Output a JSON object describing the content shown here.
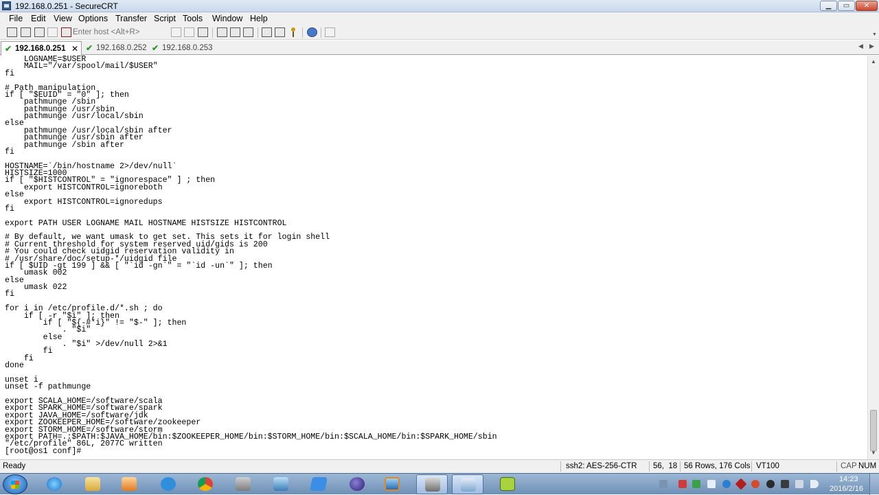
{
  "window": {
    "title": "192.168.0.251 - SecureCRT"
  },
  "menu": [
    "File",
    "Edit",
    "View",
    "Options",
    "Transfer",
    "Script",
    "Tools",
    "Window",
    "Help"
  ],
  "toolbar": {
    "host_placeholder": "Enter host <Alt+R>"
  },
  "tabs": [
    {
      "label": "192.168.0.251",
      "active": true,
      "connected": true
    },
    {
      "label": "192.168.0.252",
      "active": false,
      "connected": true
    },
    {
      "label": "192.168.0.253",
      "active": false,
      "connected": true
    }
  ],
  "terminal": {
    "lines": [
      "    LOGNAME=$USER",
      "    MAIL=\"/var/spool/mail/$USER\"",
      "fi",
      "",
      "# Path manipulation",
      "if [ \"$EUID\" = \"0\" ]; then",
      "    pathmunge /sbin",
      "    pathmunge /usr/sbin",
      "    pathmunge /usr/local/sbin",
      "else",
      "    pathmunge /usr/local/sbin after",
      "    pathmunge /usr/sbin after",
      "    pathmunge /sbin after",
      "fi",
      "",
      "HOSTNAME=`/bin/hostname 2>/dev/null`",
      "HISTSIZE=1000",
      "if [ \"$HISTCONTROL\" = \"ignorespace\" ] ; then",
      "    export HISTCONTROL=ignoreboth",
      "else",
      "    export HISTCONTROL=ignoredups",
      "fi",
      "",
      "export PATH USER LOGNAME MAIL HOSTNAME HISTSIZE HISTCONTROL",
      "",
      "# By default, we want umask to get set. This sets it for login shell",
      "# Current threshold for system reserved uid/gids is 200",
      "# You could check uidgid reservation validity in",
      "# /usr/share/doc/setup-*/uidgid file",
      "if [ $UID -gt 199 ] && [ \"`id -gn`\" = \"`id -un`\" ]; then",
      "    umask 002",
      "else",
      "    umask 022",
      "fi",
      "",
      "for i in /etc/profile.d/*.sh ; do",
      "    if [ -r \"$i\" ]; then",
      "        if [ \"${-#*i}\" != \"$-\" ]; then",
      "            . \"$i\"",
      "        else",
      "            . \"$i\" >/dev/null 2>&1",
      "        fi",
      "    fi",
      "done",
      "",
      "unset i",
      "unset -f pathmunge",
      "",
      "export SCALA_HOME=/software/scala",
      "export SPARK_HOME=/software/spark",
      "export JAVA_HOME=/software/jdk",
      "export ZOOKEEPER_HOME=/software/zookeeper",
      "export STORM_HOME=/software/storm",
      "export PATH=.:$PATH:$JAVA_HOME/bin:$ZOOKEEPER_HOME/bin:$STORM_HOME/bin:$SCALA_HOME/bin:$SPARK_HOME/sbin",
      "\"/etc/profile\" 86L, 2077C written",
      "[root@os1 conf]# "
    ]
  },
  "status": {
    "ready": "Ready",
    "cipher": "ssh2: AES-256-CTR",
    "cursor": "56,  18",
    "size": "56 Rows, 176 Cols",
    "emulation": "VT100",
    "caps": "CAP",
    "num": "NUM"
  },
  "taskbar": {
    "time": "14:23",
    "date": "2016/2/16"
  }
}
